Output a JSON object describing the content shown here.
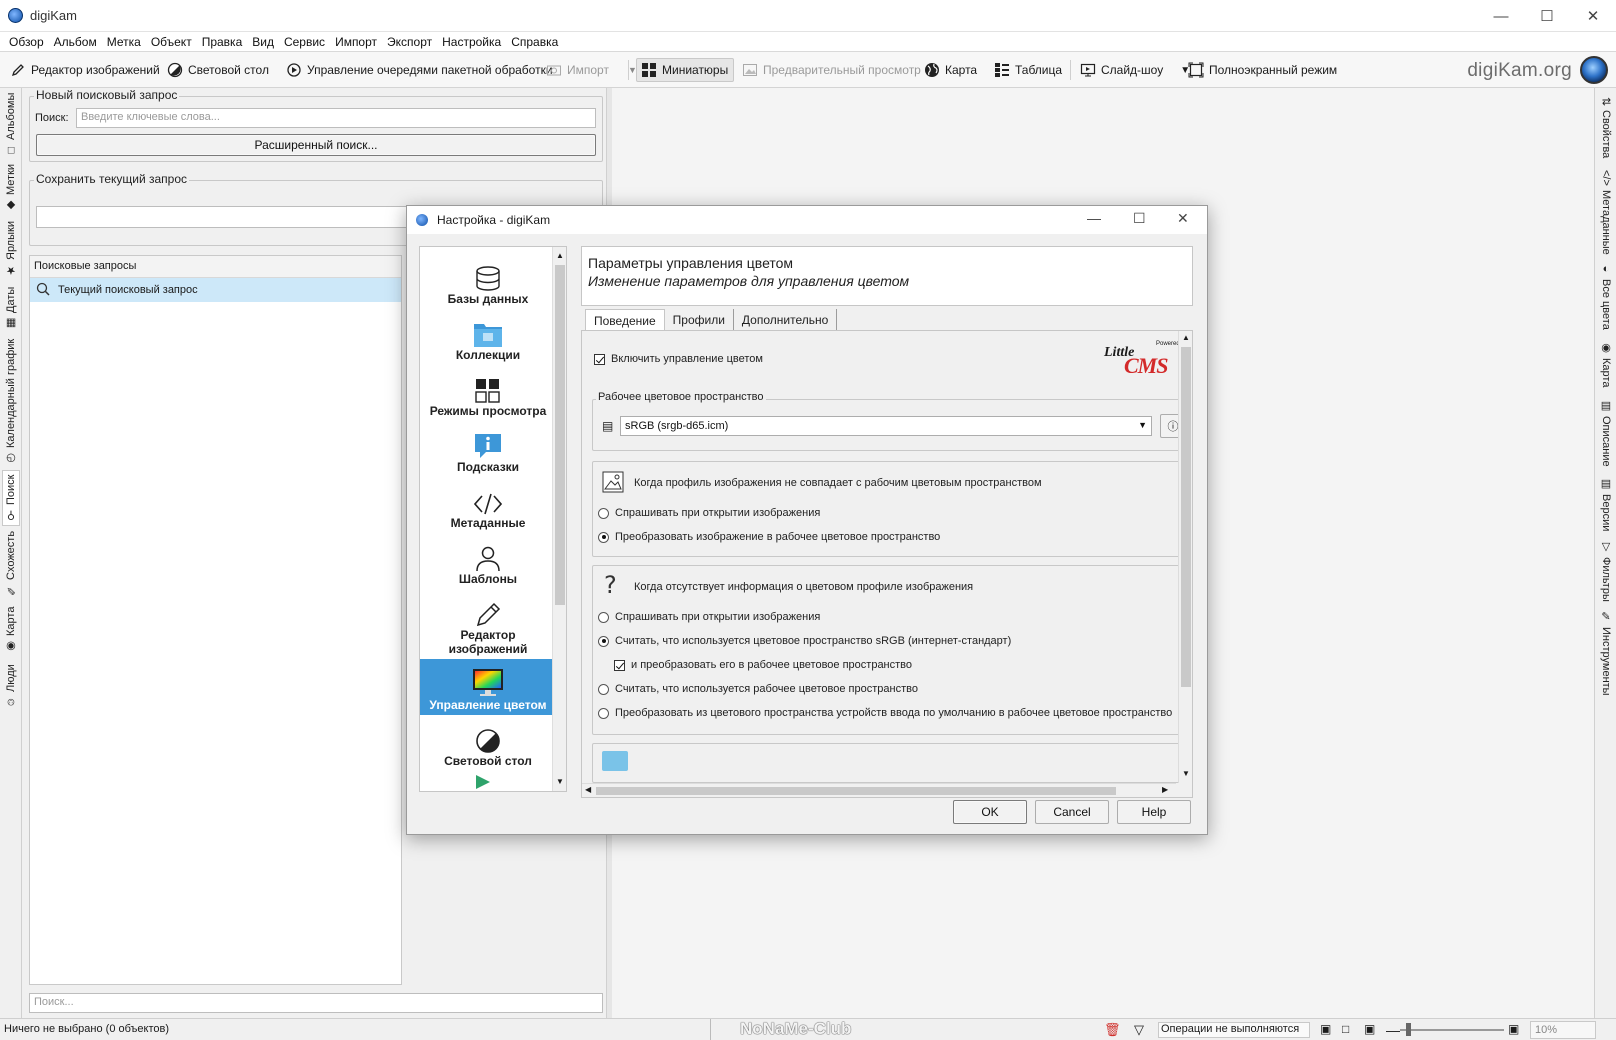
{
  "window": {
    "title": "digiKam"
  },
  "menu": [
    "Обзор",
    "Альбом",
    "Метка",
    "Объект",
    "Правка",
    "Вид",
    "Сервис",
    "Импорт",
    "Экспорт",
    "Настройка",
    "Справка"
  ],
  "toolbar": {
    "image_editor": "Редактор изображений",
    "light_table": "Световой стол",
    "batch_queue": "Управление очередями пакетной обработки",
    "import": "Импорт",
    "thumbnails": "Миниатюры",
    "preview": "Предварительный просмотр",
    "map": "Карта",
    "table": "Таблица",
    "slideshow": "Слайд-шоу",
    "fullscreen": "Полноэкранный режим",
    "site": "digiKam.org"
  },
  "left_sidebar_tabs": [
    "Альбомы",
    "Метки",
    "Ярлыки",
    "Даты",
    "Календарный график",
    "Поиск",
    "Схожесть",
    "Карта",
    "Люди"
  ],
  "right_sidebar_tabs": [
    "Свойства",
    "Метаданные",
    "Все цвета",
    "Карта",
    "Описание",
    "Версии",
    "Фильтры",
    "Инструменты"
  ],
  "search_panel": {
    "new_query_group": "Новый поисковый запрос",
    "search_label": "Поиск:",
    "search_placeholder": "Введите ключевые слова...",
    "advanced_button": "Расширенный поиск...",
    "save_group": "Сохранить текущий запрос",
    "saved_header": "Поисковые запросы",
    "current_query": "Текущий поисковый запрос",
    "filter_placeholder": "Поиск..."
  },
  "statusbar": {
    "selection": "Ничего не выбрано (0 объектов)",
    "watermark": "NoNaMe-Club",
    "operations": "Операции не выполняются",
    "zoom": "10%"
  },
  "dialog": {
    "title": "Настройка - digiKam",
    "nav": [
      "Базы данных",
      "Коллекции",
      "Режимы просмотра",
      "Подсказки",
      "Метаданные",
      "Шаблоны",
      "Редактор изображений",
      "Управление цветом",
      "Световой стол"
    ],
    "selected_nav": "Управление цветом",
    "header_title": "Параметры управления цветом",
    "header_subtitle": "Изменение параметров для управления цветом",
    "tabs": [
      "Поведение",
      "Профили",
      "Дополнительно"
    ],
    "enable_cm": "Включить управление цветом",
    "lcms_logo": {
      "little": "Little",
      "cms": "CMS",
      "powered": "Powered"
    },
    "workspace_group": "Рабочее цветовое пространство",
    "workspace_value": "sRGB (srgb-d65.icm)",
    "mismatch": {
      "title": "Когда профиль изображения не совпадает с рабочим цветовым пространством",
      "ask": "Спрашивать при открытии изображения",
      "convert": "Преобразовать изображение в рабочее цветовое пространство"
    },
    "missing": {
      "title": "Когда отсутствует информация о цветовом профиле изображения",
      "ask": "Спрашивать при открытии изображения",
      "assume_srgb": "Считать, что используется цветовое пространство sRGB (интернет-стандарт)",
      "and_convert": "и преобразовать его в рабочее цветовое пространство",
      "assume_working": "Считать, что используется рабочее цветовое пространство",
      "convert_input": "Преобразовать из цветового пространства устройств ввода по умолчанию в рабочее цветовое пространство"
    },
    "buttons": {
      "ok": "OK",
      "cancel": "Cancel",
      "help": "Help"
    }
  },
  "colors": {
    "accent": "#3d97d8",
    "selection_row": "#cde8f9",
    "titlebar": "#ffffff"
  }
}
